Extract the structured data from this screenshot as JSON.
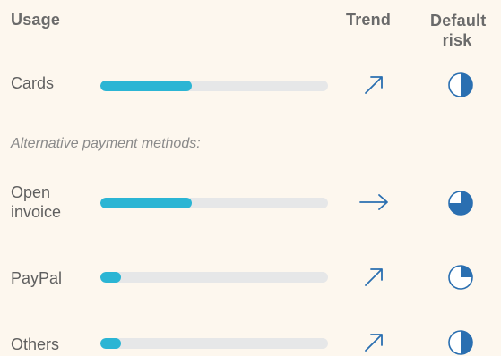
{
  "headers": {
    "usage": "Usage",
    "trend": "Trend",
    "risk_line1": "Default",
    "risk_line2": "risk"
  },
  "section_label": "Alternative payment methods:",
  "colors": {
    "bar_fill": "#2bb5d4",
    "bar_track": "#e6e7e8",
    "icon": "#2a6fb1",
    "background": "#fdf7ee"
  },
  "rows": [
    {
      "label": "Cards",
      "usage": 0.4,
      "trend": "up-right-arrow-icon",
      "risk": 0.5
    },
    {
      "label_line1": "Open",
      "label_line2": "invoice",
      "usage": 0.4,
      "trend": "right-arrow-icon",
      "risk": 0.75
    },
    {
      "label": "PayPal",
      "usage": 0.09,
      "trend": "up-right-arrow-icon",
      "risk": 0.25
    },
    {
      "label": "Others",
      "usage": 0.09,
      "trend": "up-right-arrow-icon",
      "risk": 0.5
    }
  ]
}
